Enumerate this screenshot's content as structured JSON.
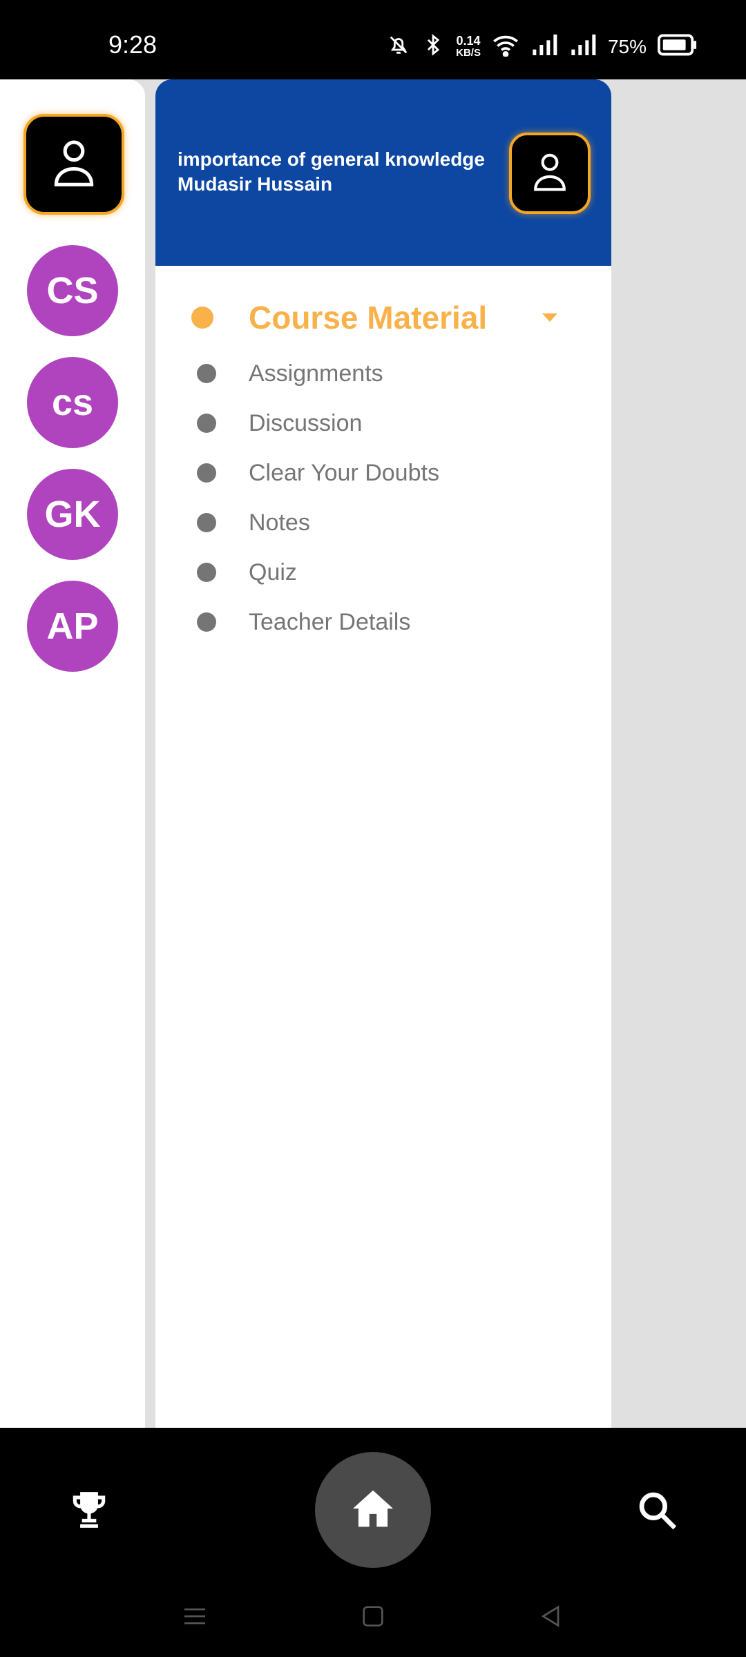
{
  "status_bar": {
    "time": "9:28",
    "net_speed_value": "0.14",
    "net_speed_unit": "KB/S",
    "battery_percent": "75%",
    "icons": [
      "bell-off-icon",
      "bluetooth-icon",
      "wifi-icon",
      "signal-icon",
      "signal-icon",
      "battery-icon"
    ]
  },
  "left_rail": {
    "logo_icon": "person-icon",
    "courses": [
      {
        "initials": "CS"
      },
      {
        "initials": "cs"
      },
      {
        "initials": "GK"
      },
      {
        "initials": "AP"
      }
    ],
    "avatar_color": "#b044bf"
  },
  "drawer": {
    "header": {
      "course_title": "importance of general knowledge",
      "teacher_name": "Mudasir Hussain",
      "background_color": "#0d47a1",
      "logo_icon": "person-icon"
    },
    "menu": [
      {
        "label": "Course Material",
        "active": true
      },
      {
        "label": "Assignments"
      },
      {
        "label": "Discussion"
      },
      {
        "label": "Clear Your Doubts"
      },
      {
        "label": "Notes"
      },
      {
        "label": "Quiz"
      },
      {
        "label": "Teacher Details"
      }
    ],
    "accent_color": "#f9b24a"
  },
  "bottom_bar": {
    "left_icon": "trophy-icon",
    "center_icon": "home-icon",
    "right_icon": "search-icon"
  },
  "system_nav": [
    "menu-icon",
    "square-icon",
    "back-icon"
  ]
}
